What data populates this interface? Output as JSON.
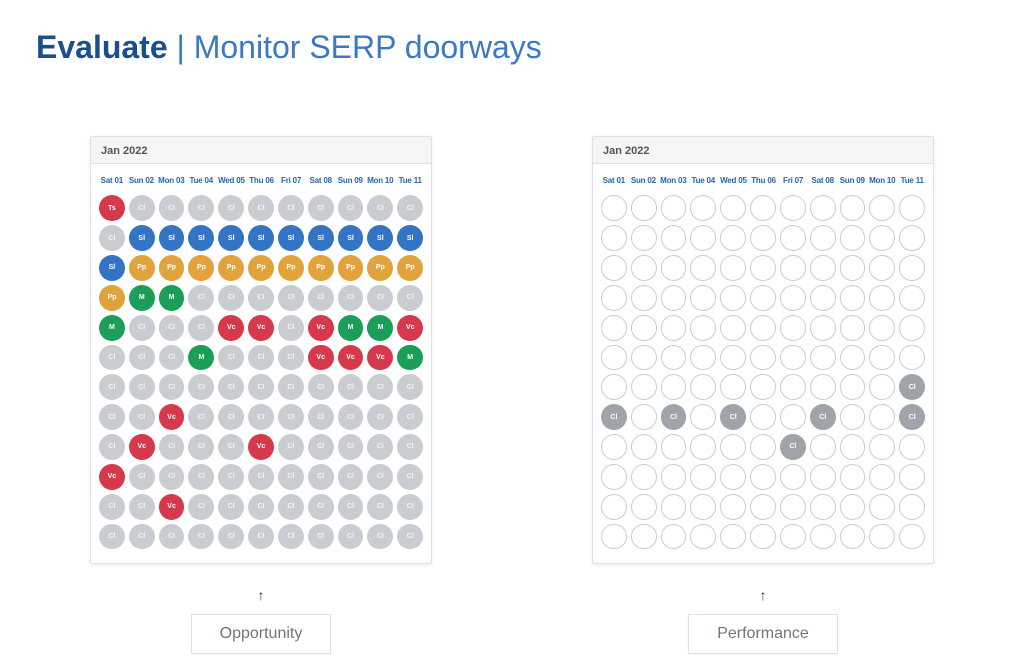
{
  "title": {
    "strong": "Evaluate",
    "separator": "|",
    "rest": "Monitor SERP doorways"
  },
  "colors": {
    "red": "#d6384c",
    "green": "#1a9e58",
    "orange": "#e2a23c",
    "blue": "#3474c4",
    "gray": "#c9cdd1",
    "darkgray": "#9ea4aa"
  },
  "legend_codes": {
    "Ts": "Ts",
    "Cl": "Cl",
    "Sl": "Sl",
    "Pp": "Pp",
    "M": "M",
    "Vc": "Vc"
  },
  "days": [
    "Sat 01",
    "Sun 02",
    "Mon 03",
    "Tue 04",
    "Wed 05",
    "Thu 06",
    "Fri 07",
    "Sat 08",
    "Sun 09",
    "Mon 10",
    "Tue 11"
  ],
  "panels": {
    "left": {
      "month": "Jan 2022",
      "label": "Opportunity",
      "rows": [
        [
          {
            "t": "Ts",
            "c": "red"
          },
          {
            "t": "Cl",
            "c": "gray"
          },
          {
            "t": "Cl",
            "c": "gray"
          },
          {
            "t": "Cl",
            "c": "gray"
          },
          {
            "t": "Cl",
            "c": "gray"
          },
          {
            "t": "Cl",
            "c": "gray"
          },
          {
            "t": "Cl",
            "c": "gray"
          },
          {
            "t": "Cl",
            "c": "gray"
          },
          {
            "t": "Cl",
            "c": "gray"
          },
          {
            "t": "Cl",
            "c": "gray"
          },
          {
            "t": "Cl",
            "c": "gray"
          }
        ],
        [
          {
            "t": "Cl",
            "c": "gray"
          },
          {
            "t": "Sl",
            "c": "blue"
          },
          {
            "t": "Sl",
            "c": "blue"
          },
          {
            "t": "Sl",
            "c": "blue"
          },
          {
            "t": "Sl",
            "c": "blue"
          },
          {
            "t": "Sl",
            "c": "blue"
          },
          {
            "t": "Sl",
            "c": "blue"
          },
          {
            "t": "Sl",
            "c": "blue"
          },
          {
            "t": "Sl",
            "c": "blue"
          },
          {
            "t": "Sl",
            "c": "blue"
          },
          {
            "t": "Sl",
            "c": "blue"
          }
        ],
        [
          {
            "t": "Sl",
            "c": "blue"
          },
          {
            "t": "Pp",
            "c": "orange"
          },
          {
            "t": "Pp",
            "c": "orange"
          },
          {
            "t": "Pp",
            "c": "orange"
          },
          {
            "t": "Pp",
            "c": "orange"
          },
          {
            "t": "Pp",
            "c": "orange"
          },
          {
            "t": "Pp",
            "c": "orange"
          },
          {
            "t": "Pp",
            "c": "orange"
          },
          {
            "t": "Pp",
            "c": "orange"
          },
          {
            "t": "Pp",
            "c": "orange"
          },
          {
            "t": "Pp",
            "c": "orange"
          }
        ],
        [
          {
            "t": "Pp",
            "c": "orange"
          },
          {
            "t": "M",
            "c": "green"
          },
          {
            "t": "M",
            "c": "green"
          },
          {
            "t": "Cl",
            "c": "gray"
          },
          {
            "t": "Cl",
            "c": "gray"
          },
          {
            "t": "Cl",
            "c": "gray"
          },
          {
            "t": "Cl",
            "c": "gray"
          },
          {
            "t": "Cl",
            "c": "gray"
          },
          {
            "t": "Cl",
            "c": "gray"
          },
          {
            "t": "Cl",
            "c": "gray"
          },
          {
            "t": "Cl",
            "c": "gray"
          }
        ],
        [
          {
            "t": "M",
            "c": "green"
          },
          {
            "t": "Cl",
            "c": "gray"
          },
          {
            "t": "Cl",
            "c": "gray"
          },
          {
            "t": "Cl",
            "c": "gray"
          },
          {
            "t": "Vc",
            "c": "red"
          },
          {
            "t": "Vc",
            "c": "red"
          },
          {
            "t": "Cl",
            "c": "gray"
          },
          {
            "t": "Vc",
            "c": "red"
          },
          {
            "t": "M",
            "c": "green"
          },
          {
            "t": "M",
            "c": "green"
          },
          {
            "t": "Vc",
            "c": "red"
          }
        ],
        [
          {
            "t": "Cl",
            "c": "gray"
          },
          {
            "t": "Cl",
            "c": "gray"
          },
          {
            "t": "Cl",
            "c": "gray"
          },
          {
            "t": "M",
            "c": "green"
          },
          {
            "t": "Cl",
            "c": "gray"
          },
          {
            "t": "Cl",
            "c": "gray"
          },
          {
            "t": "Cl",
            "c": "gray"
          },
          {
            "t": "Vc",
            "c": "red"
          },
          {
            "t": "Vc",
            "c": "red"
          },
          {
            "t": "Vc",
            "c": "red"
          },
          {
            "t": "M",
            "c": "green"
          }
        ],
        [
          {
            "t": "Cl",
            "c": "gray"
          },
          {
            "t": "Cl",
            "c": "gray"
          },
          {
            "t": "Cl",
            "c": "gray"
          },
          {
            "t": "Cl",
            "c": "gray"
          },
          {
            "t": "Cl",
            "c": "gray"
          },
          {
            "t": "Cl",
            "c": "gray"
          },
          {
            "t": "Cl",
            "c": "gray"
          },
          {
            "t": "Cl",
            "c": "gray"
          },
          {
            "t": "Cl",
            "c": "gray"
          },
          {
            "t": "Cl",
            "c": "gray"
          },
          {
            "t": "Cl",
            "c": "gray"
          }
        ],
        [
          {
            "t": "Cl",
            "c": "gray"
          },
          {
            "t": "Cl",
            "c": "gray"
          },
          {
            "t": "Vc",
            "c": "red"
          },
          {
            "t": "Cl",
            "c": "gray"
          },
          {
            "t": "Cl",
            "c": "gray"
          },
          {
            "t": "Cl",
            "c": "gray"
          },
          {
            "t": "Cl",
            "c": "gray"
          },
          {
            "t": "Cl",
            "c": "gray"
          },
          {
            "t": "Cl",
            "c": "gray"
          },
          {
            "t": "Cl",
            "c": "gray"
          },
          {
            "t": "Cl",
            "c": "gray"
          }
        ],
        [
          {
            "t": "Cl",
            "c": "gray"
          },
          {
            "t": "Vc",
            "c": "red"
          },
          {
            "t": "Cl",
            "c": "gray"
          },
          {
            "t": "Cl",
            "c": "gray"
          },
          {
            "t": "Cl",
            "c": "gray"
          },
          {
            "t": "Vc",
            "c": "red"
          },
          {
            "t": "Cl",
            "c": "gray"
          },
          {
            "t": "Cl",
            "c": "gray"
          },
          {
            "t": "Cl",
            "c": "gray"
          },
          {
            "t": "Cl",
            "c": "gray"
          },
          {
            "t": "Cl",
            "c": "gray"
          }
        ],
        [
          {
            "t": "Vc",
            "c": "red"
          },
          {
            "t": "Cl",
            "c": "gray"
          },
          {
            "t": "Cl",
            "c": "gray"
          },
          {
            "t": "Cl",
            "c": "gray"
          },
          {
            "t": "Cl",
            "c": "gray"
          },
          {
            "t": "Cl",
            "c": "gray"
          },
          {
            "t": "Cl",
            "c": "gray"
          },
          {
            "t": "Cl",
            "c": "gray"
          },
          {
            "t": "Cl",
            "c": "gray"
          },
          {
            "t": "Cl",
            "c": "gray"
          },
          {
            "t": "Cl",
            "c": "gray"
          }
        ],
        [
          {
            "t": "Cl",
            "c": "gray"
          },
          {
            "t": "Cl",
            "c": "gray"
          },
          {
            "t": "Vc",
            "c": "red"
          },
          {
            "t": "Cl",
            "c": "gray"
          },
          {
            "t": "Cl",
            "c": "gray"
          },
          {
            "t": "Cl",
            "c": "gray"
          },
          {
            "t": "Cl",
            "c": "gray"
          },
          {
            "t": "Cl",
            "c": "gray"
          },
          {
            "t": "Cl",
            "c": "gray"
          },
          {
            "t": "Cl",
            "c": "gray"
          },
          {
            "t": "Cl",
            "c": "gray"
          }
        ],
        [
          {
            "t": "Cl",
            "c": "gray"
          },
          {
            "t": "Cl",
            "c": "gray"
          },
          {
            "t": "Cl",
            "c": "gray"
          },
          {
            "t": "Cl",
            "c": "gray"
          },
          {
            "t": "Cl",
            "c": "gray"
          },
          {
            "t": "Cl",
            "c": "gray"
          },
          {
            "t": "Cl",
            "c": "gray"
          },
          {
            "t": "Cl",
            "c": "gray"
          },
          {
            "t": "Cl",
            "c": "gray"
          },
          {
            "t": "Cl",
            "c": "gray"
          },
          {
            "t": "Cl",
            "c": "gray"
          }
        ]
      ]
    },
    "right": {
      "month": "Jan 2022",
      "label": "Performance",
      "rows": [
        [
          {
            "c": "empty"
          },
          {
            "c": "empty"
          },
          {
            "c": "empty"
          },
          {
            "c": "empty"
          },
          {
            "c": "empty"
          },
          {
            "c": "empty"
          },
          {
            "c": "empty"
          },
          {
            "c": "empty"
          },
          {
            "c": "empty"
          },
          {
            "c": "empty"
          },
          {
            "c": "empty"
          }
        ],
        [
          {
            "c": "empty"
          },
          {
            "c": "empty"
          },
          {
            "c": "empty"
          },
          {
            "c": "empty"
          },
          {
            "c": "empty"
          },
          {
            "c": "empty"
          },
          {
            "c": "empty"
          },
          {
            "c": "empty"
          },
          {
            "c": "empty"
          },
          {
            "c": "empty"
          },
          {
            "c": "empty"
          }
        ],
        [
          {
            "c": "empty"
          },
          {
            "c": "empty"
          },
          {
            "c": "empty"
          },
          {
            "c": "empty"
          },
          {
            "c": "empty"
          },
          {
            "c": "empty"
          },
          {
            "c": "empty"
          },
          {
            "c": "empty"
          },
          {
            "c": "empty"
          },
          {
            "c": "empty"
          },
          {
            "c": "empty"
          }
        ],
        [
          {
            "c": "empty"
          },
          {
            "c": "empty"
          },
          {
            "c": "empty"
          },
          {
            "c": "empty"
          },
          {
            "c": "empty"
          },
          {
            "c": "empty"
          },
          {
            "c": "empty"
          },
          {
            "c": "empty"
          },
          {
            "c": "empty"
          },
          {
            "c": "empty"
          },
          {
            "c": "empty"
          }
        ],
        [
          {
            "c": "empty"
          },
          {
            "c": "empty"
          },
          {
            "c": "empty"
          },
          {
            "c": "empty"
          },
          {
            "c": "empty"
          },
          {
            "c": "empty"
          },
          {
            "c": "empty"
          },
          {
            "c": "empty"
          },
          {
            "c": "empty"
          },
          {
            "c": "empty"
          },
          {
            "c": "empty"
          }
        ],
        [
          {
            "c": "empty"
          },
          {
            "c": "empty"
          },
          {
            "c": "empty"
          },
          {
            "c": "empty"
          },
          {
            "c": "empty"
          },
          {
            "c": "empty"
          },
          {
            "c": "empty"
          },
          {
            "c": "empty"
          },
          {
            "c": "empty"
          },
          {
            "c": "empty"
          },
          {
            "c": "empty"
          }
        ],
        [
          {
            "c": "empty"
          },
          {
            "c": "empty"
          },
          {
            "c": "empty"
          },
          {
            "c": "empty"
          },
          {
            "c": "empty"
          },
          {
            "c": "empty"
          },
          {
            "c": "empty"
          },
          {
            "c": "empty"
          },
          {
            "c": "empty"
          },
          {
            "c": "empty"
          },
          {
            "t": "Cl",
            "c": "darkgray"
          }
        ],
        [
          {
            "t": "Cl",
            "c": "darkgray"
          },
          {
            "c": "empty"
          },
          {
            "t": "Cl",
            "c": "darkgray"
          },
          {
            "c": "empty"
          },
          {
            "t": "Cl",
            "c": "darkgray"
          },
          {
            "c": "empty"
          },
          {
            "c": "empty"
          },
          {
            "t": "Cl",
            "c": "darkgray"
          },
          {
            "c": "empty"
          },
          {
            "c": "empty"
          },
          {
            "t": "Cl",
            "c": "darkgray"
          }
        ],
        [
          {
            "c": "empty"
          },
          {
            "c": "empty"
          },
          {
            "c": "empty"
          },
          {
            "c": "empty"
          },
          {
            "c": "empty"
          },
          {
            "c": "empty"
          },
          {
            "t": "Cl",
            "c": "darkgray"
          },
          {
            "c": "empty"
          },
          {
            "c": "empty"
          },
          {
            "c": "empty"
          },
          {
            "c": "empty"
          }
        ],
        [
          {
            "c": "empty"
          },
          {
            "c": "empty"
          },
          {
            "c": "empty"
          },
          {
            "c": "empty"
          },
          {
            "c": "empty"
          },
          {
            "c": "empty"
          },
          {
            "c": "empty"
          },
          {
            "c": "empty"
          },
          {
            "c": "empty"
          },
          {
            "c": "empty"
          },
          {
            "c": "empty"
          }
        ],
        [
          {
            "c": "empty"
          },
          {
            "c": "empty"
          },
          {
            "c": "empty"
          },
          {
            "c": "empty"
          },
          {
            "c": "empty"
          },
          {
            "c": "empty"
          },
          {
            "c": "empty"
          },
          {
            "c": "empty"
          },
          {
            "c": "empty"
          },
          {
            "c": "empty"
          },
          {
            "c": "empty"
          }
        ],
        [
          {
            "c": "empty"
          },
          {
            "c": "empty"
          },
          {
            "c": "empty"
          },
          {
            "c": "empty"
          },
          {
            "c": "empty"
          },
          {
            "c": "empty"
          },
          {
            "c": "empty"
          },
          {
            "c": "empty"
          },
          {
            "c": "empty"
          },
          {
            "c": "empty"
          },
          {
            "c": "empty"
          }
        ]
      ]
    }
  }
}
